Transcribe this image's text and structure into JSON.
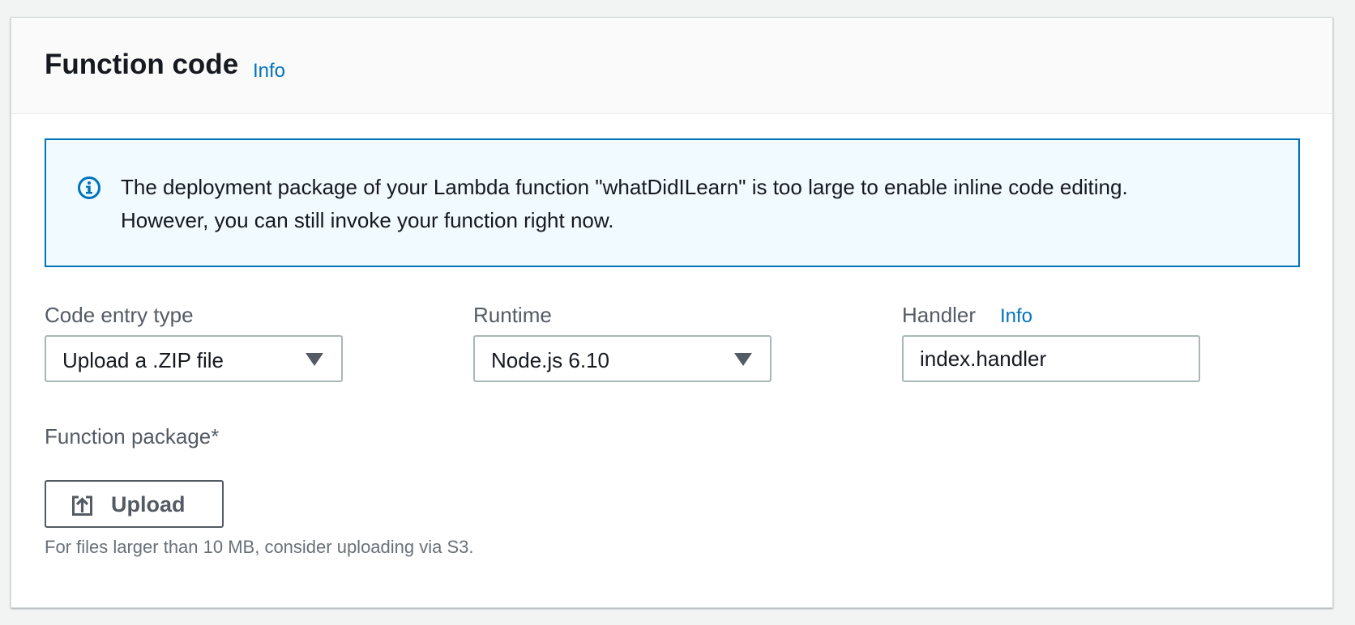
{
  "panel": {
    "title": "Function code",
    "info_label": "Info"
  },
  "alert": {
    "icon": "info-circle-icon",
    "line1": "The deployment package of your Lambda function \"whatDidILearn\" is too large to enable inline code editing.",
    "line2": "However, you can still invoke your function right now."
  },
  "fields": {
    "code_entry_type": {
      "label": "Code entry type",
      "value": "Upload a .ZIP file"
    },
    "runtime": {
      "label": "Runtime",
      "value": "Node.js 6.10"
    },
    "handler": {
      "label": "Handler",
      "info_label": "Info",
      "value": "index.handler"
    },
    "function_package": {
      "label": "Function package*",
      "button_label": "Upload",
      "button_icon": "upload-icon",
      "hint": "For files larger than 10 MB, consider uploading via S3."
    }
  },
  "colors": {
    "link": "#0073bb",
    "alert_border": "#0073bb",
    "alert_background": "#f1faff",
    "label": "#545b64"
  }
}
